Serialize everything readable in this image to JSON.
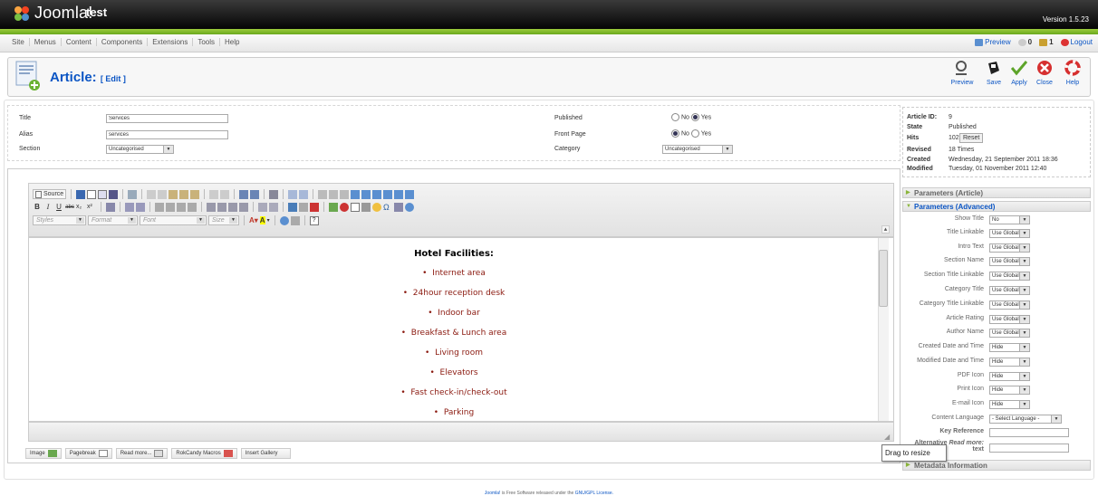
{
  "header": {
    "logo_text": "Joomla!",
    "site_name": "test",
    "version": "Version 1.5.23"
  },
  "menu": {
    "items": [
      "Site",
      "Menus",
      "Content",
      "Components",
      "Extensions",
      "Tools",
      "Help"
    ],
    "preview": "Preview",
    "messages_count": "0",
    "users_count": "1",
    "logout": "Logout"
  },
  "toolbar": {
    "title": "Article:",
    "subtitle": "[ Edit ]",
    "buttons": [
      {
        "label": "Preview",
        "icon": "preview-icon"
      },
      {
        "label": "Save",
        "icon": "save-icon"
      },
      {
        "label": "Apply",
        "icon": "apply-icon"
      },
      {
        "label": "Close",
        "icon": "close-icon"
      },
      {
        "label": "Help",
        "icon": "help-icon"
      }
    ]
  },
  "details": {
    "title_label": "Title",
    "title_value": "Services",
    "alias_label": "Alias",
    "alias_value": "services",
    "section_label": "Section",
    "section_value": "Uncategorised",
    "published_label": "Published",
    "frontpage_label": "Front Page",
    "category_label": "Category",
    "category_value": "Uncategorised",
    "no": "No",
    "yes": "Yes"
  },
  "info": {
    "article_id_label": "Article ID:",
    "article_id": "9",
    "state_label": "State",
    "state": "Published",
    "hits_label": "Hits",
    "hits": "102",
    "reset": "Reset",
    "revised_label": "Revised",
    "revised": "18 Times",
    "created_label": "Created",
    "created": "Wednesday, 21 September 2011 18:36",
    "modified_label": "Modified",
    "modified": "Tuesday, 01 November 2011 12:40"
  },
  "editor": {
    "source_label": "Source",
    "styles": "Styles",
    "format": "Format",
    "font": "Font",
    "size": "Size",
    "heading": "Hotel Facilities:",
    "bullets": [
      "Internet area",
      "24hour reception desk",
      "Indoor bar",
      "Breakfast & Lunch area",
      "Living room",
      "Elevators",
      "Fast check-in/check-out",
      "Parking"
    ]
  },
  "editor_buttons": [
    "Image",
    "Pagebreak",
    "Read more...",
    "RokCandy Macros",
    "Insert Gallery"
  ],
  "params": {
    "article_head": "Parameters (Article)",
    "advanced_head": "Parameters (Advanced)",
    "metadata_head": "Metadata Information",
    "rows": [
      {
        "label": "Show Title",
        "value": "No"
      },
      {
        "label": "Title Linkable",
        "value": "Use Global"
      },
      {
        "label": "Intro Text",
        "value": "Use Global"
      },
      {
        "label": "Section Name",
        "value": "Use Global"
      },
      {
        "label": "Section Title Linkable",
        "value": "Use Global"
      },
      {
        "label": "Category Title",
        "value": "Use Global"
      },
      {
        "label": "Category Title Linkable",
        "value": "Use Global"
      },
      {
        "label": "Article Rating",
        "value": "Use Global"
      },
      {
        "label": "Author Name",
        "value": "Use Global"
      },
      {
        "label": "Created Date and Time",
        "value": "Hide"
      },
      {
        "label": "Modified Date and Time",
        "value": "Hide"
      },
      {
        "label": "PDF Icon",
        "value": "Hide"
      },
      {
        "label": "Print Icon",
        "value": "Hide"
      },
      {
        "label": "E-mail Icon",
        "value": "Hide"
      },
      {
        "label": "Content Language",
        "value": "- Select Language -"
      }
    ],
    "key_reference": "Key Reference",
    "alt_read_more_1": "Alternative",
    "alt_read_more_em": "Read more:",
    "alt_read_more_2": "text"
  },
  "tooltip": "Drag to resize",
  "footer": {
    "link1": "Joomla!",
    "middle": "is Free Software released under the",
    "link2": "GNU/GPL License."
  }
}
